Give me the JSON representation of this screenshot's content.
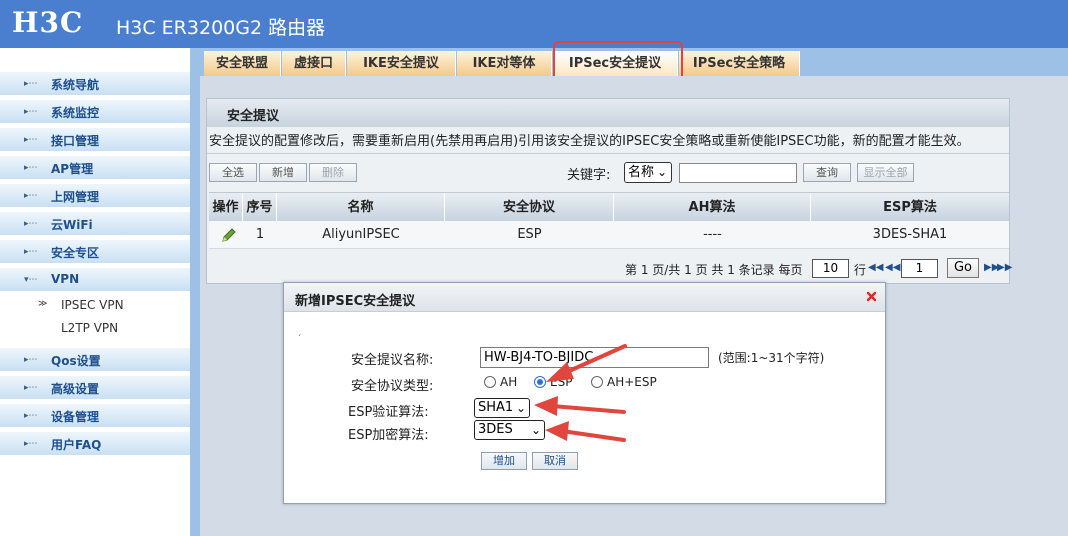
{
  "header": {
    "logo": "H3C",
    "product": "H3C ER3200G2 路由器"
  },
  "sidebar": {
    "items": [
      {
        "label": "系统导航"
      },
      {
        "label": "系统监控"
      },
      {
        "label": "接口管理"
      },
      {
        "label": "AP管理"
      },
      {
        "label": "上网管理"
      },
      {
        "label": "云WiFi"
      },
      {
        "label": "安全专区"
      },
      {
        "label": "VPN"
      },
      {
        "label": "Qos设置"
      },
      {
        "label": "高级设置"
      },
      {
        "label": "设备管理"
      },
      {
        "label": "用户FAQ"
      }
    ],
    "sub_items": [
      {
        "label": "IPSEC VPN"
      },
      {
        "label": "L2TP VPN"
      }
    ]
  },
  "tabs": [
    {
      "label": "安全联盟"
    },
    {
      "label": "虚接口"
    },
    {
      "label": "IKE安全提议"
    },
    {
      "label": "IKE对等体"
    },
    {
      "label": "IPSec安全提议"
    },
    {
      "label": "IPSec安全策略"
    }
  ],
  "active_tab": "IPSec安全提议",
  "panel": {
    "title": "安全提议",
    "notice": "安全提议的配置修改后，需要重新启用(先禁用再启用)引用该安全提议的IPSEC安全策略或重新使能IPSEC功能，新的配置才能生效。",
    "toolbar": {
      "select_all": "全选",
      "add": "新增",
      "delete": "删除",
      "keyword_label": "关键字:",
      "keyword_option": "名称",
      "keyword_value": "",
      "query": "查询",
      "show_all": "显示全部"
    },
    "table": {
      "columns": [
        "操作",
        "序号",
        "名称",
        "安全协议",
        "AH算法",
        "ESP算法"
      ],
      "rows": [
        {
          "index": "1",
          "name": "AliyunIPSEC",
          "protocol": "ESP",
          "ah": "----",
          "esp": "3DES-SHA1"
        }
      ]
    },
    "pager": {
      "summary": "第 1 页/共 1 页 共 1 条记录 每页",
      "per_page": "10",
      "unit": "行",
      "page": "1",
      "go": "Go"
    }
  },
  "dialog": {
    "title": "新增IPSEC安全提议",
    "mark": "ˏ",
    "name_label": "安全提议名称:",
    "name_value": "HW-BJ4-TO-BJIDC",
    "name_hint": "(范围:1~31个字符)",
    "protocol_label": "安全协议类型:",
    "protocol_options": [
      "AH",
      "ESP",
      "AH+ESP"
    ],
    "protocol_selected": "ESP",
    "auth_label": "ESP验证算法:",
    "auth_value": "SHA1",
    "encrypt_label": "ESP加密算法:",
    "encrypt_value": "3DES",
    "add_button": "增加",
    "cancel_button": "取消"
  },
  "colors": {
    "header_bg": "#4a7fcf",
    "sidebar_text": "#1f4f8c",
    "tab_bg": "#f3c98a",
    "highlight": "#e0463e"
  }
}
